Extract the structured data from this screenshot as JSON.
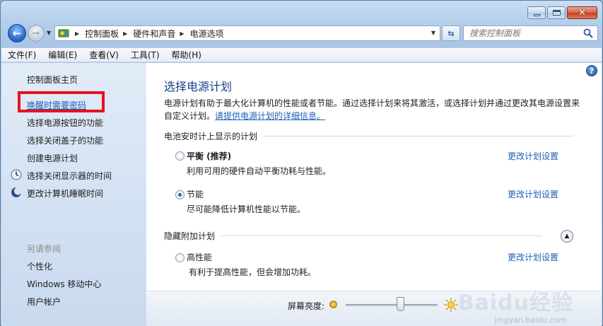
{
  "nav": {
    "breadcrumbs": [
      "控制面板",
      "硬件和声音",
      "电源选项"
    ],
    "search_placeholder": "搜索控制面板"
  },
  "menu": [
    "文件(F)",
    "编辑(E)",
    "查看(V)",
    "工具(T)",
    "帮助(H)"
  ],
  "sidebar": {
    "home": "控制面板主页",
    "links": [
      {
        "label": "唤醒时需要密码",
        "highlighted": true
      },
      {
        "label": "选择电源按钮的功能"
      },
      {
        "label": "选择关闭盖子的功能"
      },
      {
        "label": "创建电源计划"
      },
      {
        "label": "选择关闭显示器的时间",
        "icon": "display-icon"
      },
      {
        "label": "更改计算机睡眠时间",
        "icon": "moon-icon"
      }
    ],
    "see_also_title": "另请参阅",
    "see_also": [
      "个性化",
      "Windows 移动中心",
      "用户帐户"
    ]
  },
  "main": {
    "title": "选择电源计划",
    "desc": "电源计划有助于最大化计算机的性能或者节能。通过选择计划来将其激活，或选择计划并通过更改其电源设置来自定义计划。",
    "desc_link": "请提供电源计划的详细信息。",
    "section1": "电池安时计上显示的计划",
    "plans": [
      {
        "name": "平衡 (推荐)",
        "desc": "利用可用的硬件自动平衡功耗与性能。",
        "link": "更改计划设置",
        "selected": false
      },
      {
        "name": "节能",
        "desc": "尽可能降低计算机性能以节能。",
        "link": "更改计划设置",
        "selected": true
      }
    ],
    "section2": "隐藏附加计划",
    "hidden_plans": [
      {
        "name": "高性能",
        "desc": "有利于提高性能，但会增加功耗。",
        "link": "更改计划设置",
        "selected": false
      }
    ]
  },
  "brightness": {
    "label": "屏幕亮度:",
    "level": 0.6
  },
  "watermark": {
    "text": "Baidu经验",
    "sub": "jingyan.baidu.com"
  },
  "colors": {
    "accent": "#1e5fb4",
    "title": "#1a3f88",
    "highlight": "#e8121e"
  }
}
